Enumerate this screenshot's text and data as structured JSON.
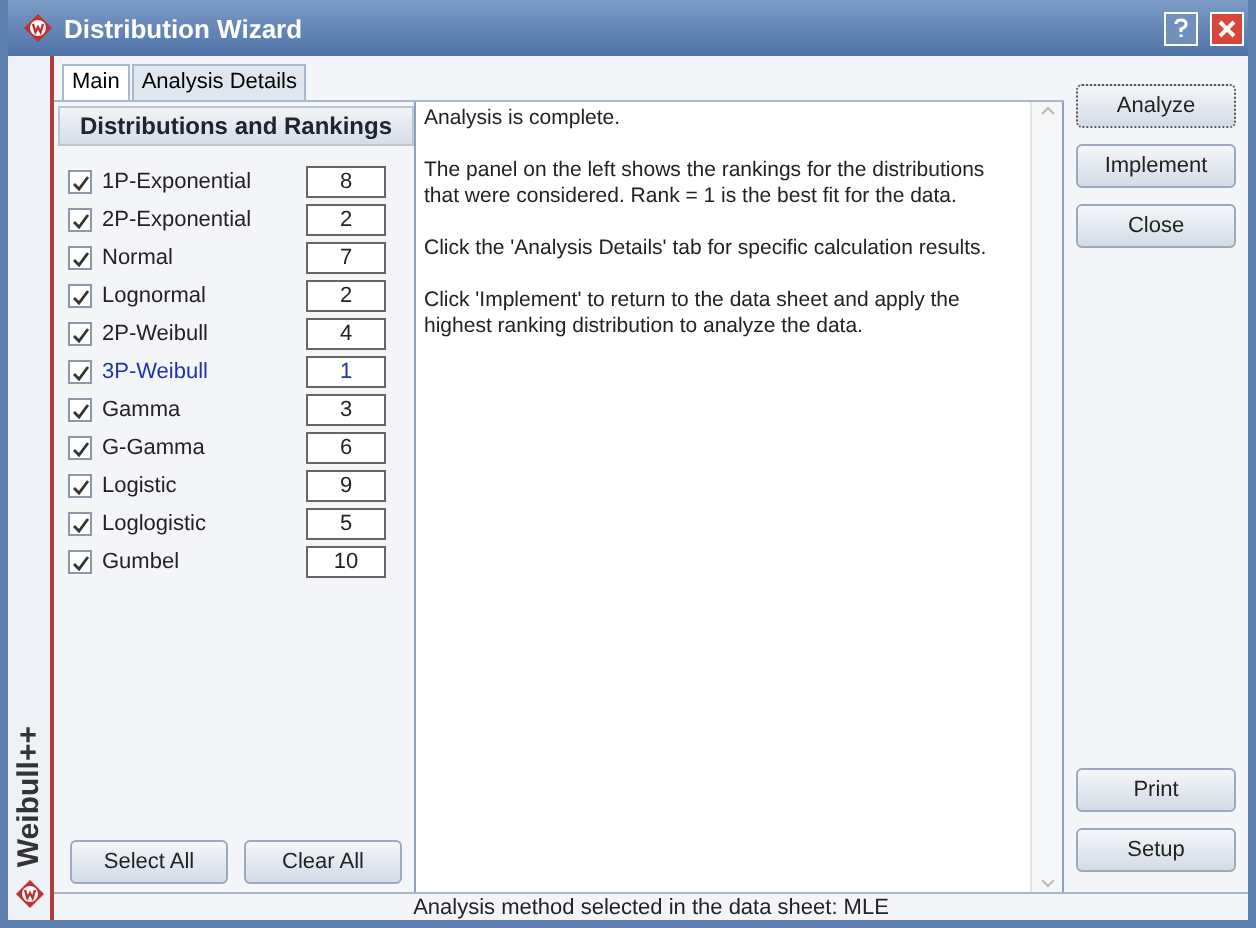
{
  "window": {
    "title": "Distribution Wizard",
    "brand": "Weibull++"
  },
  "tabs": [
    {
      "label": "Main",
      "selected": true
    },
    {
      "label": "Analysis Details",
      "selected": false
    }
  ],
  "rankings": {
    "heading": "Distributions and Rankings",
    "items": [
      {
        "label": "1P-Exponential",
        "checked": true,
        "rank": "8",
        "highlighted": false
      },
      {
        "label": "2P-Exponential",
        "checked": true,
        "rank": "2",
        "highlighted": false
      },
      {
        "label": "Normal",
        "checked": true,
        "rank": "7",
        "highlighted": false
      },
      {
        "label": "Lognormal",
        "checked": true,
        "rank": "2",
        "highlighted": false
      },
      {
        "label": "2P-Weibull",
        "checked": true,
        "rank": "4",
        "highlighted": false
      },
      {
        "label": "3P-Weibull",
        "checked": true,
        "rank": "1",
        "highlighted": true
      },
      {
        "label": "Gamma",
        "checked": true,
        "rank": "3",
        "highlighted": false
      },
      {
        "label": "G-Gamma",
        "checked": true,
        "rank": "6",
        "highlighted": false
      },
      {
        "label": "Logistic",
        "checked": true,
        "rank": "9",
        "highlighted": false
      },
      {
        "label": "Loglogistic",
        "checked": true,
        "rank": "5",
        "highlighted": false
      },
      {
        "label": "Gumbel",
        "checked": true,
        "rank": "10",
        "highlighted": false
      }
    ],
    "buttons": [
      "Select All",
      "Clear All"
    ]
  },
  "message": [
    "Analysis is complete.",
    "The panel on the left shows the rankings for the distributions that were considered. Rank = 1 is the best fit for the data.",
    "Click the 'Analysis Details' tab for specific calculation results.",
    "Click 'Implement' to return to the data sheet and apply the highest ranking distribution to analyze the data."
  ],
  "actions_top": [
    {
      "label": "Analyze",
      "focused": true
    },
    {
      "label": "Implement",
      "focused": false
    },
    {
      "label": "Close",
      "focused": false
    }
  ],
  "actions_bottom": [
    "Print",
    "Setup"
  ],
  "status_bar": "Analysis method selected in the data sheet: MLE"
}
